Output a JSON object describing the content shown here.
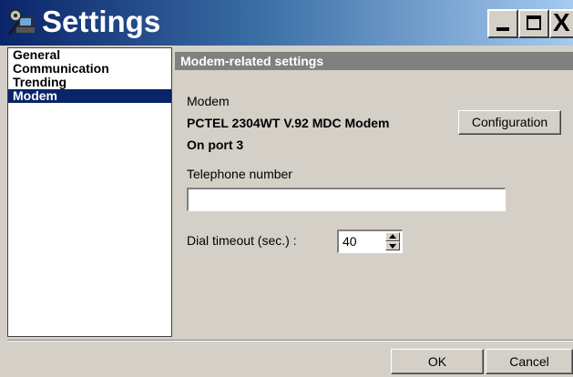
{
  "window": {
    "title": "Settings",
    "icon": "settings-app-icon",
    "controls": {
      "minimize": "_",
      "maximize": "□",
      "close": "X"
    }
  },
  "sidebar": {
    "items": [
      {
        "label": "General",
        "selected": false
      },
      {
        "label": "Communication",
        "selected": false
      },
      {
        "label": "Trending",
        "selected": false
      },
      {
        "label": "Modem",
        "selected": true
      }
    ]
  },
  "panel": {
    "header": "Modem-related settings",
    "modem_label": "Modem",
    "modem_name": "PCTEL 2304WT V.92 MDC Modem",
    "modem_port": "On port 3",
    "configuration_button": "Configuration",
    "telephone_label": "Telephone number",
    "telephone_value": "",
    "dial_timeout_label": "Dial timeout (sec.) :",
    "dial_timeout_value": "40"
  },
  "footer": {
    "ok_label": "OK",
    "cancel_label": "Cancel"
  },
  "colors": {
    "title_gradient_start": "#0a246a",
    "title_gradient_end": "#a6caf0",
    "selection": "#0a246a",
    "panel_header": "#808080",
    "face": "#d4d0c8"
  }
}
